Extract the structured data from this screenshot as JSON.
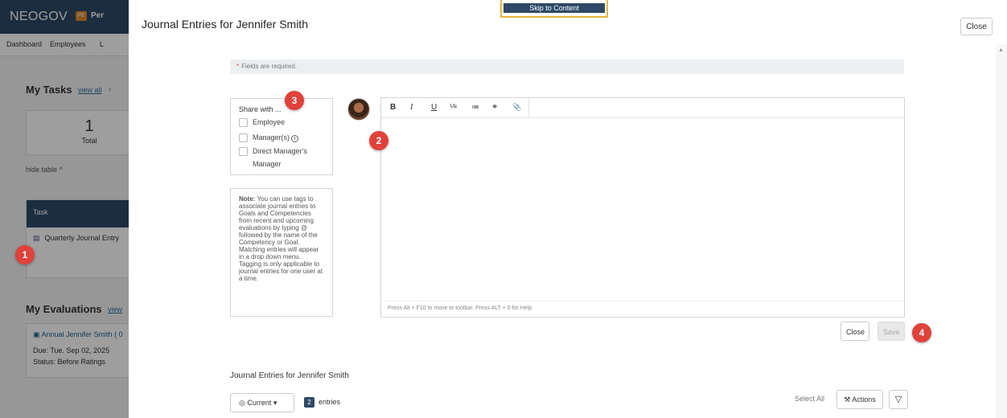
{
  "background": {
    "brand": "NEOGOV",
    "pe_badge": "PE",
    "pe_label": "Per",
    "nav": [
      "Dashboard",
      "Employees",
      "L"
    ],
    "tasks_title": "My Tasks",
    "view_all": "view all",
    "total_count": "1",
    "total_label": "Total",
    "hide_table": "hide table",
    "task_header": "Task",
    "task_row": "Quarterly Journal Entry",
    "evaluations_title": "My Evaluations",
    "evaluations_view": "view",
    "eval_link": "Annual Jennifer Smith ( 0",
    "eval_due": "Due: Tue. Sep 02, 2025",
    "eval_status": "Status: Before Ratings"
  },
  "skip_link": "Skip to Content",
  "modal": {
    "title": "Journal Entries for Jennifer Smith",
    "close_top": "Close",
    "required_note": "Fields are required.",
    "share_title": "Share with ...",
    "share_options": [
      "Employee",
      "Manager(s)",
      "Direct Manager's",
      "Manager"
    ],
    "note_bold": "Note:",
    "note_text": "You can use tags to associate journal entries to Goals and Competencies from recent and upcoming evaluations by typing @ followed by the name of the Competency or Goal. Matching entries will appear in a drop down menu. Tagging is only applicable to journal entries for one user at a time.",
    "toolbar": [
      "B",
      "I",
      "U",
      "⅟≡",
      "≔",
      "⚭",
      "📎"
    ],
    "editor_help": "Press Alt + F10 to move to toolbar. Press ALT + 0 for Help.",
    "close_button": "Close",
    "save_button": "Save",
    "list_title": "Journal Entries for Jennifer Smith",
    "current_filter": "Current",
    "entries_count": "2",
    "entries_label": "entries",
    "select_all": "Select All",
    "actions_button": "Actions"
  },
  "badges": [
    "1",
    "2",
    "3",
    "4"
  ],
  "colors": {
    "header_navy": "#2c4a66",
    "badge_red": "#e0413b",
    "skip_border": "#e7b73c"
  }
}
